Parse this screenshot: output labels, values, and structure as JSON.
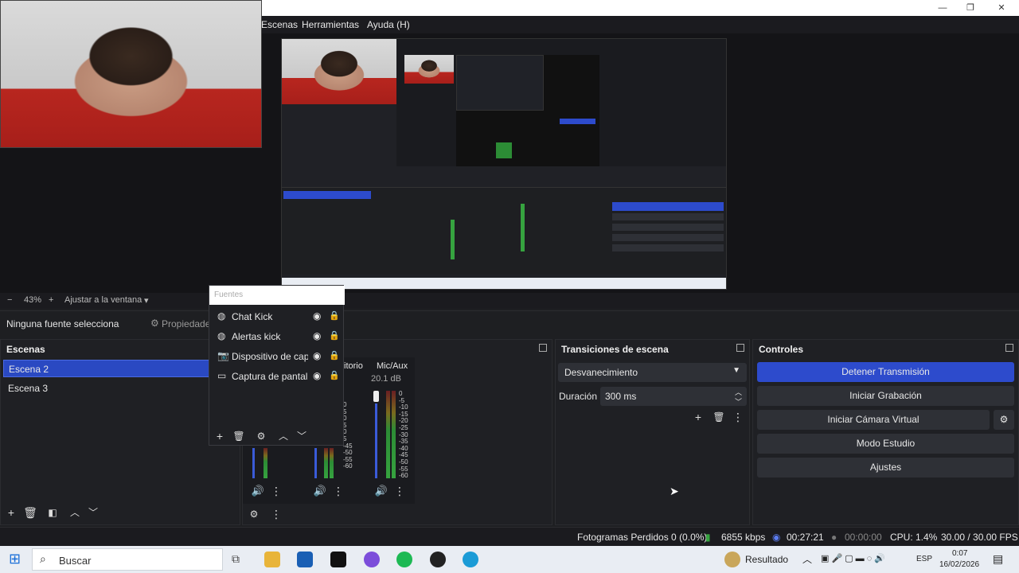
{
  "menu": {
    "escenas": "Escenas",
    "herramientas": "Herramientas",
    "ayuda": "Ayuda (H)"
  },
  "zoom": {
    "minus": "−",
    "value": "43%",
    "plus": "+",
    "fit": "Ajustar a la ventana",
    "dropdown": "▾"
  },
  "sourcebar": {
    "no_source": "Ninguna fuente selecciona",
    "properties": "Propiedade"
  },
  "scenes": {
    "title": "Escenas",
    "items": [
      {
        "label": "Escena 2",
        "selected": true
      },
      {
        "label": "Escena 3",
        "selected": false
      }
    ]
  },
  "sources_popup": {
    "title": "Fuentes",
    "items": [
      {
        "label": "Chat Kick",
        "icon": "globe-icon"
      },
      {
        "label": "Alertas kick",
        "icon": "globe-icon"
      },
      {
        "label": "Dispositivo de cap",
        "icon": "camera-icon"
      },
      {
        "label": "Captura de pantall",
        "icon": "monitor-icon"
      }
    ]
  },
  "mixer": {
    "channel_partial": "itorio",
    "mic_label": "Mic/Aux",
    "mic_db": "20.1 dB",
    "scale": [
      "0",
      "-5",
      "-10",
      "-15",
      "-20",
      "-25",
      "-30",
      "-35",
      "-40",
      "-45",
      "-50",
      "-55",
      "-60"
    ],
    "left_scale": [
      "0",
      "5",
      "0",
      "5",
      "0",
      "5",
      "-45",
      "-50",
      "-55",
      "-60"
    ]
  },
  "transitions": {
    "title": "Transiciones de escena",
    "selected": "Desvanecimiento",
    "duration_label": "Duración",
    "duration_value": "300 ms"
  },
  "controls": {
    "title": "Controles",
    "buttons": [
      "Detener Transmisión",
      "Iniciar Grabación",
      "Iniciar Cámara Virtual",
      "Modo Estudio",
      "Ajustes"
    ]
  },
  "status": {
    "dropped": "Fotogramas Perdidos 0 (0.0%)",
    "bitrate": "6855 kbps",
    "stream_time": "00:27:21",
    "rec_time": "00:00:00",
    "cpu": "CPU: 1.4%",
    "fps": "30.00 / 30.00 FPS"
  },
  "taskbar": {
    "search": "Buscar",
    "result": "Resultado",
    "lang": "ESP",
    "time": "0:07",
    "date": "16/02/2026"
  },
  "colors": {
    "accent": "#2d4bcc",
    "panel": "#1f2024",
    "bg": "#1e1f22"
  }
}
